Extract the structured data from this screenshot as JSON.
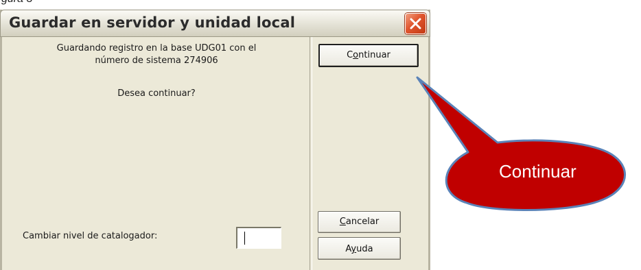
{
  "caption": "gura 3",
  "window": {
    "title": "Guardar en servidor y unidad local",
    "close_icon": "close-icon"
  },
  "message": {
    "line1": "Guardando registro en la base UDG01 con el",
    "line2": "número de sistema 274906",
    "question": "Desea continuar?"
  },
  "buttons": {
    "continuar": {
      "pre": "C",
      "accel": "o",
      "post": "ntinuar"
    },
    "cancelar": {
      "pre": "",
      "accel": "C",
      "post": "ancelar"
    },
    "ayuda": {
      "pre": "A",
      "accel": "y",
      "post": "uda"
    }
  },
  "level": {
    "label": "Cambiar nivel de catalogador:",
    "value": ""
  },
  "callout": {
    "text": "Continuar",
    "fill": "#c00000",
    "edge": "#5b83b8"
  }
}
